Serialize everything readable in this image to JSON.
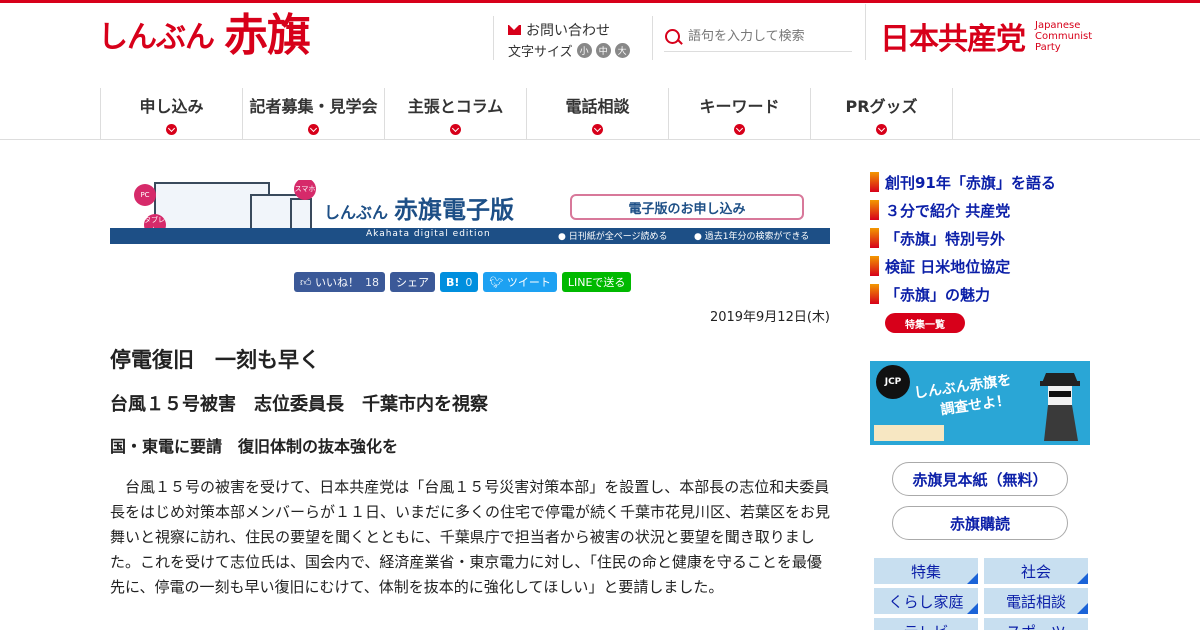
{
  "header": {
    "logo_small": "しんぶん",
    "logo_big": "赤旗",
    "contact_label": "お問い合わせ",
    "fontsize_label": "文字サイズ",
    "fontsize_options": [
      "小",
      "中",
      "大"
    ],
    "search_placeholder": "語句を入力して検索",
    "party_name": "日本共産党",
    "party_en_1": "Japanese",
    "party_en_2": "Communist",
    "party_en_3": "Party"
  },
  "nav": {
    "items": [
      {
        "label": "申し込み"
      },
      {
        "label": "記者募集・見学会"
      },
      {
        "label": "主張とコラム"
      },
      {
        "label": "電話相談"
      },
      {
        "label": "キーワード"
      },
      {
        "label": "PRグッズ"
      }
    ]
  },
  "banner": {
    "pc_badge": "PC",
    "sp_badge": "スマホ",
    "tablet_badge": "タブレット",
    "title_small": "しんぶん",
    "title_big": "赤旗電子版",
    "subtitle_en": "Akahata digital edition",
    "button_label": "電子版のお申し込み",
    "note_1": "● 日刊紙が全ページ読める",
    "note_2": "● 過去1年分の検索ができる"
  },
  "share": {
    "like_label": "いいね！",
    "like_count": "18",
    "share_label": "シェア",
    "hatena_label": "B!",
    "hatena_count": "0",
    "tweet_label": "ツイート",
    "line_label": "LINEで送る"
  },
  "article": {
    "date": "2019年9月12日(木)",
    "title": "停電復旧　一刻も早く",
    "subtitle": "台風１５号被害　志位委員長　千葉市内を視察",
    "heading": "国・東電に要請　復旧体制の抜本強化を",
    "body": "台風１５号の被害を受けて、日本共産党は「台風１５号災害対策本部」を設置し、本部長の志位和夫委員長をはじめ対策本部メンバーらが１１日、いまだに多くの住宅で停電が続く千葉市花見川区、若葉区をお見舞いと視察に訪れ、住民の要望を聞くとともに、千葉県庁で担当者から被害の状況と要望を聞き取りました。これを受けて志位氏は、国会内で、経済産業省・東京電力に対し、「住民の命と健康を守ることを最優先に、停電の一刻も早い復旧にむけて、体制を抜本的に強化してほしい」と要請しました。"
  },
  "sidebar": {
    "links": [
      {
        "label": "創刊91年「赤旗」を語る"
      },
      {
        "label": "３分で紹介 共産党"
      },
      {
        "label": "「赤旗」特別号外"
      },
      {
        "label": "検証 日米地位協定"
      },
      {
        "label": "「赤旗」の魅力"
      }
    ],
    "features_button": "特集一覧",
    "promo_badge": "JCP",
    "promo_title_1": "しんぶん赤旗を",
    "promo_title_2": "調査せよ！",
    "sample_button": "赤旗見本紙（無料）",
    "subscribe_button": "赤旗購読",
    "categories": [
      {
        "label": "特集"
      },
      {
        "label": "社会"
      },
      {
        "label": "くらし家庭"
      },
      {
        "label": "電話相談"
      },
      {
        "label": "テレビ"
      },
      {
        "label": "スポーツ"
      }
    ]
  },
  "colors": {
    "accent": "#d7001a",
    "link": "#0b1fa8",
    "banner_blue": "#1d4f86",
    "category_bg": "#c8dff0"
  }
}
